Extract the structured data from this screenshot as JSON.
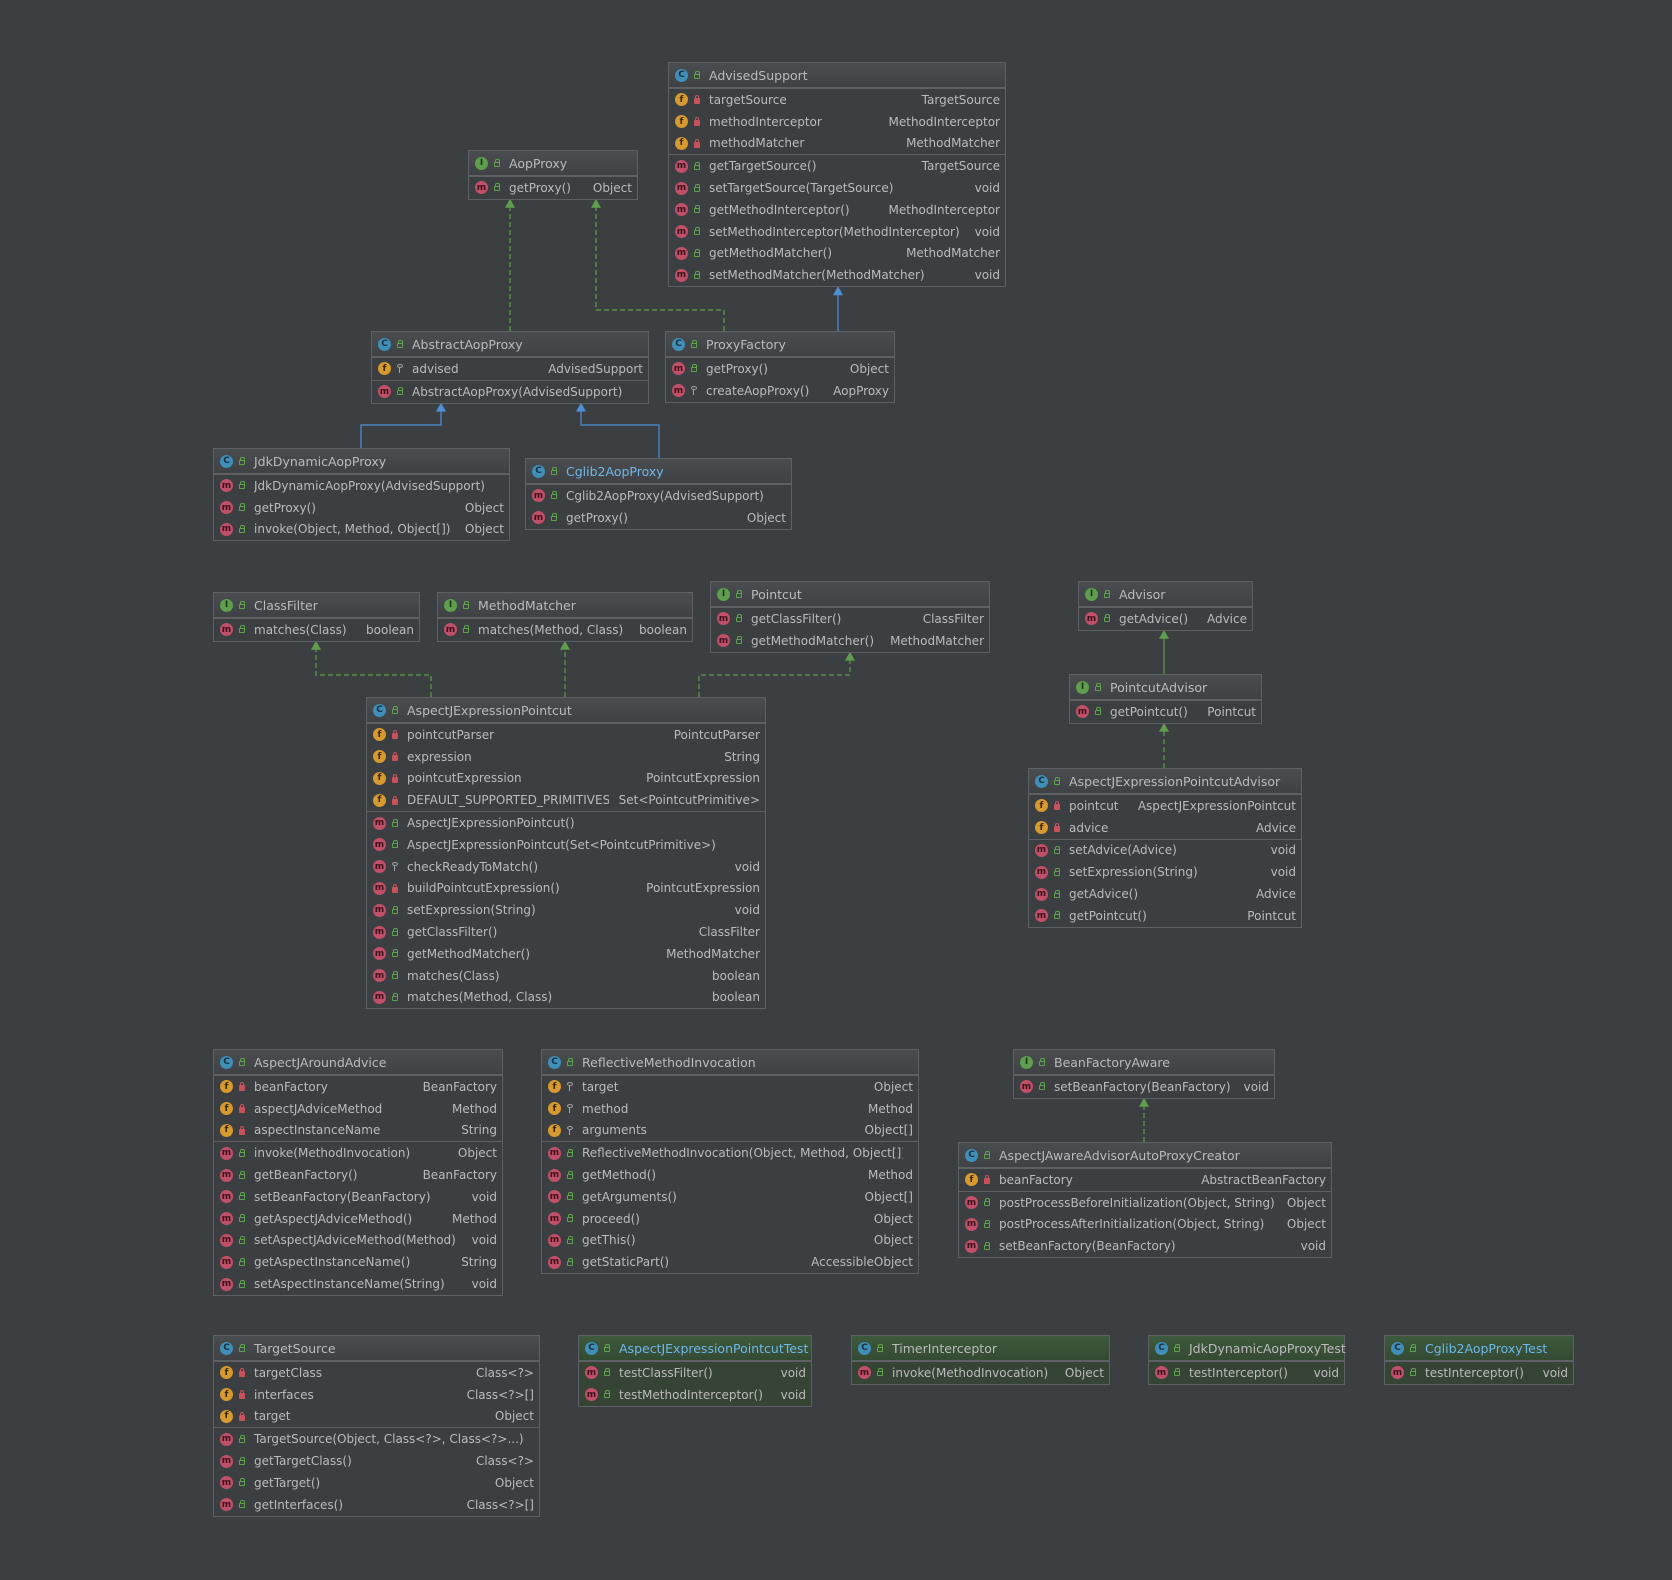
{
  "colors": {
    "background": "#3c3f41",
    "implements_edge": "#5e9e4e",
    "extends_edge": "#4e8fd6",
    "link_text": "#6fb7e9"
  },
  "classes": [
    {
      "id": "AdvisedSupport",
      "kind": "c",
      "name": "AdvisedSupport",
      "sections": [
        [
          {
            "k": "f",
            "v": "private",
            "n": "targetSource",
            "t": "TargetSource"
          },
          {
            "k": "f",
            "v": "private",
            "n": "methodInterceptor",
            "t": "MethodInterceptor"
          },
          {
            "k": "f",
            "v": "private",
            "n": "methodMatcher",
            "t": "MethodMatcher"
          }
        ],
        [
          {
            "k": "m",
            "v": "public",
            "n": "getTargetSource()",
            "t": "TargetSource"
          },
          {
            "k": "m",
            "v": "public",
            "n": "setTargetSource(TargetSource)",
            "t": "void"
          },
          {
            "k": "m",
            "v": "public",
            "n": "getMethodInterceptor()",
            "t": "MethodInterceptor"
          },
          {
            "k": "m",
            "v": "public",
            "n": "setMethodInterceptor(MethodInterceptor)",
            "t": "void"
          },
          {
            "k": "m",
            "v": "public",
            "n": "getMethodMatcher()",
            "t": "MethodMatcher"
          },
          {
            "k": "m",
            "v": "public",
            "n": "setMethodMatcher(MethodMatcher)",
            "t": "void"
          }
        ]
      ]
    },
    {
      "id": "AopProxy",
      "kind": "i",
      "name": "AopProxy",
      "sections": [
        [
          {
            "k": "m",
            "v": "public",
            "n": "getProxy()",
            "t": "Object"
          }
        ]
      ]
    },
    {
      "id": "AbstractAopProxy",
      "kind": "c",
      "name": "AbstractAopProxy",
      "sections": [
        [
          {
            "k": "f",
            "v": "protected",
            "n": "advised",
            "t": "AdvisedSupport"
          }
        ],
        [
          {
            "k": "m",
            "v": "public",
            "n": "AbstractAopProxy(AdvisedSupport)",
            "t": ""
          }
        ]
      ]
    },
    {
      "id": "ProxyFactory",
      "kind": "c",
      "name": "ProxyFactory",
      "sections": [
        [
          {
            "k": "m",
            "v": "public",
            "n": "getProxy()",
            "t": "Object"
          },
          {
            "k": "m",
            "v": "protected",
            "n": "createAopProxy()",
            "t": "AopProxy"
          }
        ]
      ]
    },
    {
      "id": "JdkDynamicAopProxy",
      "kind": "c",
      "name": "JdkDynamicAopProxy",
      "sections": [
        [
          {
            "k": "m",
            "v": "public",
            "n": "JdkDynamicAopProxy(AdvisedSupport)",
            "t": ""
          },
          {
            "k": "m",
            "v": "public",
            "n": "getProxy()",
            "t": "Object"
          },
          {
            "k": "m",
            "v": "public",
            "n": "invoke(Object, Method, Object[])",
            "t": "Object"
          }
        ]
      ]
    },
    {
      "id": "Cglib2AopProxy",
      "kind": "c",
      "name": "Cglib2AopProxy",
      "link": true,
      "sections": [
        [
          {
            "k": "m",
            "v": "public",
            "n": "Cglib2AopProxy(AdvisedSupport)",
            "t": ""
          },
          {
            "k": "m",
            "v": "public",
            "n": "getProxy()",
            "t": "Object"
          }
        ]
      ]
    },
    {
      "id": "ClassFilter",
      "kind": "i",
      "name": "ClassFilter",
      "sections": [
        [
          {
            "k": "m",
            "v": "public",
            "n": "matches(Class)",
            "t": "boolean"
          }
        ]
      ]
    },
    {
      "id": "MethodMatcher",
      "kind": "i",
      "name": "MethodMatcher",
      "sections": [
        [
          {
            "k": "m",
            "v": "public",
            "n": "matches(Method, Class)",
            "t": "boolean"
          }
        ]
      ]
    },
    {
      "id": "Pointcut",
      "kind": "i",
      "name": "Pointcut",
      "sections": [
        [
          {
            "k": "m",
            "v": "public",
            "n": "getClassFilter()",
            "t": "ClassFilter"
          },
          {
            "k": "m",
            "v": "public",
            "n": "getMethodMatcher()",
            "t": "MethodMatcher"
          }
        ]
      ]
    },
    {
      "id": "Advisor",
      "kind": "i",
      "name": "Advisor",
      "sections": [
        [
          {
            "k": "m",
            "v": "public",
            "n": "getAdvice()",
            "t": "Advice"
          }
        ]
      ]
    },
    {
      "id": "PointcutAdvisor",
      "kind": "i",
      "name": "PointcutAdvisor",
      "sections": [
        [
          {
            "k": "m",
            "v": "public",
            "n": "getPointcut()",
            "t": "Pointcut"
          }
        ]
      ]
    },
    {
      "id": "AspectJExpressionPointcut",
      "kind": "c",
      "name": "AspectJExpressionPointcut",
      "sections": [
        [
          {
            "k": "f",
            "v": "private",
            "n": "pointcutParser",
            "t": "PointcutParser"
          },
          {
            "k": "f",
            "v": "private",
            "n": "expression",
            "t": "String"
          },
          {
            "k": "f",
            "v": "private",
            "n": "pointcutExpression",
            "t": "PointcutExpression"
          },
          {
            "k": "f",
            "v": "private",
            "n": "DEFAULT_SUPPORTED_PRIMITIVES",
            "t": "Set<PointcutPrimitive>"
          }
        ],
        [
          {
            "k": "m",
            "v": "public",
            "n": "AspectJExpressionPointcut()",
            "t": ""
          },
          {
            "k": "m",
            "v": "public",
            "n": "AspectJExpressionPointcut(Set<PointcutPrimitive>)",
            "t": ""
          },
          {
            "k": "m",
            "v": "protected",
            "n": "checkReadyToMatch()",
            "t": "void"
          },
          {
            "k": "m",
            "v": "private",
            "n": "buildPointcutExpression()",
            "t": "PointcutExpression"
          },
          {
            "k": "m",
            "v": "public",
            "n": "setExpression(String)",
            "t": "void"
          },
          {
            "k": "m",
            "v": "public",
            "n": "getClassFilter()",
            "t": "ClassFilter"
          },
          {
            "k": "m",
            "v": "public",
            "n": "getMethodMatcher()",
            "t": "MethodMatcher"
          },
          {
            "k": "m",
            "v": "public",
            "n": "matches(Class)",
            "t": "boolean"
          },
          {
            "k": "m",
            "v": "public",
            "n": "matches(Method, Class)",
            "t": "boolean"
          }
        ]
      ]
    },
    {
      "id": "AspectJExpressionPointcutAdvisor",
      "kind": "c",
      "name": "AspectJExpressionPointcutAdvisor",
      "sections": [
        [
          {
            "k": "f",
            "v": "private",
            "n": "pointcut",
            "t": "AspectJExpressionPointcut"
          },
          {
            "k": "f",
            "v": "private",
            "n": "advice",
            "t": "Advice"
          }
        ],
        [
          {
            "k": "m",
            "v": "public",
            "n": "setAdvice(Advice)",
            "t": "void"
          },
          {
            "k": "m",
            "v": "public",
            "n": "setExpression(String)",
            "t": "void"
          },
          {
            "k": "m",
            "v": "public",
            "n": "getAdvice()",
            "t": "Advice"
          },
          {
            "k": "m",
            "v": "public",
            "n": "getPointcut()",
            "t": "Pointcut"
          }
        ]
      ]
    },
    {
      "id": "AspectJAroundAdvice",
      "kind": "c",
      "name": "AspectJAroundAdvice",
      "sections": [
        [
          {
            "k": "f",
            "v": "private",
            "n": "beanFactory",
            "t": "BeanFactory"
          },
          {
            "k": "f",
            "v": "private",
            "n": "aspectJAdviceMethod",
            "t": "Method"
          },
          {
            "k": "f",
            "v": "private",
            "n": "aspectInstanceName",
            "t": "String"
          }
        ],
        [
          {
            "k": "m",
            "v": "public",
            "n": "invoke(MethodInvocation)",
            "t": "Object"
          },
          {
            "k": "m",
            "v": "public",
            "n": "getBeanFactory()",
            "t": "BeanFactory"
          },
          {
            "k": "m",
            "v": "public",
            "n": "setBeanFactory(BeanFactory)",
            "t": "void"
          },
          {
            "k": "m",
            "v": "public",
            "n": "getAspectJAdviceMethod()",
            "t": "Method"
          },
          {
            "k": "m",
            "v": "public",
            "n": "setAspectJAdviceMethod(Method)",
            "t": "void"
          },
          {
            "k": "m",
            "v": "public",
            "n": "getAspectInstanceName()",
            "t": "String"
          },
          {
            "k": "m",
            "v": "public",
            "n": "setAspectInstanceName(String)",
            "t": "void"
          }
        ]
      ]
    },
    {
      "id": "ReflectiveMethodInvocation",
      "kind": "c",
      "name": "ReflectiveMethodInvocation",
      "sections": [
        [
          {
            "k": "f",
            "v": "protected",
            "n": "target",
            "t": "Object"
          },
          {
            "k": "f",
            "v": "protected",
            "n": "method",
            "t": "Method"
          },
          {
            "k": "f",
            "v": "protected",
            "n": "arguments",
            "t": "Object[]"
          }
        ],
        [
          {
            "k": "m",
            "v": "public",
            "n": "ReflectiveMethodInvocation(Object, Method, Object[])",
            "t": ""
          },
          {
            "k": "m",
            "v": "public",
            "n": "getMethod()",
            "t": "Method"
          },
          {
            "k": "m",
            "v": "public",
            "n": "getArguments()",
            "t": "Object[]"
          },
          {
            "k": "m",
            "v": "public",
            "n": "proceed()",
            "t": "Object"
          },
          {
            "k": "m",
            "v": "public",
            "n": "getThis()",
            "t": "Object"
          },
          {
            "k": "m",
            "v": "public",
            "n": "getStaticPart()",
            "t": "AccessibleObject"
          }
        ]
      ]
    },
    {
      "id": "BeanFactoryAware",
      "kind": "i",
      "name": "BeanFactoryAware",
      "sections": [
        [
          {
            "k": "m",
            "v": "public",
            "n": "setBeanFactory(BeanFactory)",
            "t": "void"
          }
        ]
      ]
    },
    {
      "id": "AspectJAwareAdvisorAutoProxyCreator",
      "kind": "c",
      "name": "AspectJAwareAdvisorAutoProxyCreator",
      "sections": [
        [
          {
            "k": "f",
            "v": "private",
            "n": "beanFactory",
            "t": "AbstractBeanFactory"
          }
        ],
        [
          {
            "k": "m",
            "v": "public",
            "n": "postProcessBeforeInitialization(Object, String)",
            "t": "Object"
          },
          {
            "k": "m",
            "v": "public",
            "n": "postProcessAfterInitialization(Object, String)",
            "t": "Object"
          },
          {
            "k": "m",
            "v": "public",
            "n": "setBeanFactory(BeanFactory)",
            "t": "void"
          }
        ]
      ]
    },
    {
      "id": "TargetSource",
      "kind": "c",
      "name": "TargetSource",
      "sections": [
        [
          {
            "k": "f",
            "v": "private",
            "n": "targetClass",
            "t": "Class<?>"
          },
          {
            "k": "f",
            "v": "private",
            "n": "interfaces",
            "t": "Class<?>[]"
          },
          {
            "k": "f",
            "v": "private",
            "n": "target",
            "t": "Object"
          }
        ],
        [
          {
            "k": "m",
            "v": "public",
            "n": "TargetSource(Object, Class<?>, Class<?>...)",
            "t": ""
          },
          {
            "k": "m",
            "v": "public",
            "n": "getTargetClass()",
            "t": "Class<?>"
          },
          {
            "k": "m",
            "v": "public",
            "n": "getTarget()",
            "t": "Object"
          },
          {
            "k": "m",
            "v": "public",
            "n": "getInterfaces()",
            "t": "Class<?>[]"
          }
        ]
      ]
    },
    {
      "id": "AspectJExpressionPointcutTest",
      "kind": "c",
      "name": "AspectJExpressionPointcutTest",
      "link": true,
      "test": true,
      "sections": [
        [
          {
            "k": "m",
            "v": "public",
            "n": "testClassFilter()",
            "t": "void"
          },
          {
            "k": "m",
            "v": "public",
            "n": "testMethodInterceptor()",
            "t": "void"
          }
        ]
      ]
    },
    {
      "id": "TimerInterceptor",
      "kind": "c",
      "name": "TimerInterceptor",
      "test": true,
      "sections": [
        [
          {
            "k": "m",
            "v": "public",
            "n": "invoke(MethodInvocation)",
            "t": "Object"
          }
        ]
      ]
    },
    {
      "id": "JdkDynamicAopProxyTest",
      "kind": "c",
      "name": "JdkDynamicAopProxyTest",
      "test": true,
      "sections": [
        [
          {
            "k": "m",
            "v": "public",
            "n": "testInterceptor()",
            "t": "void"
          }
        ]
      ]
    },
    {
      "id": "Cglib2AopProxyTest",
      "kind": "c",
      "name": "Cglib2AopProxyTest",
      "link": true,
      "test": true,
      "sections": [
        [
          {
            "k": "m",
            "v": "public",
            "n": "testInterceptor()",
            "t": "void"
          }
        ]
      ]
    }
  ],
  "relations": [
    {
      "from": "AbstractAopProxy",
      "to": "AopProxy",
      "type": "implements"
    },
    {
      "from": "ProxyFactory",
      "to": "AopProxy",
      "type": "implements"
    },
    {
      "from": "ProxyFactory",
      "to": "AdvisedSupport",
      "type": "extends"
    },
    {
      "from": "JdkDynamicAopProxy",
      "to": "AbstractAopProxy",
      "type": "extends"
    },
    {
      "from": "Cglib2AopProxy",
      "to": "AbstractAopProxy",
      "type": "extends"
    },
    {
      "from": "AspectJExpressionPointcut",
      "to": "ClassFilter",
      "type": "implements"
    },
    {
      "from": "AspectJExpressionPointcut",
      "to": "MethodMatcher",
      "type": "implements"
    },
    {
      "from": "AspectJExpressionPointcut",
      "to": "Pointcut",
      "type": "implements"
    },
    {
      "from": "PointcutAdvisor",
      "to": "Advisor",
      "type": "extends-interface"
    },
    {
      "from": "AspectJExpressionPointcutAdvisor",
      "to": "PointcutAdvisor",
      "type": "implements"
    },
    {
      "from": "AspectJAwareAdvisorAutoProxyCreator",
      "to": "BeanFactoryAware",
      "type": "implements"
    }
  ]
}
